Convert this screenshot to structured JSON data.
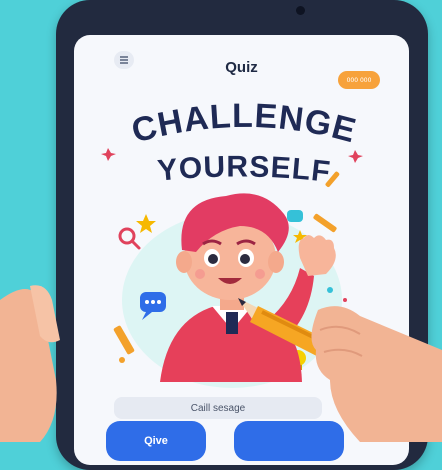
{
  "header": {
    "menu_icon": "menu-icon",
    "title": "Quiz",
    "pill_label": "000 000"
  },
  "hero": {
    "line1": "CHALLENGE",
    "line2": "YOURSELF"
  },
  "form": {
    "field_value": "Caill sesage",
    "primary_label": "Qive",
    "secondary_label": ""
  },
  "colors": {
    "background": "#4fd0d8",
    "device_frame": "#222a3f",
    "screen": "#f6f8fc",
    "headline": "#1f2a55",
    "accent_orange": "#f7a23b",
    "button_blue": "#2f6de8"
  }
}
